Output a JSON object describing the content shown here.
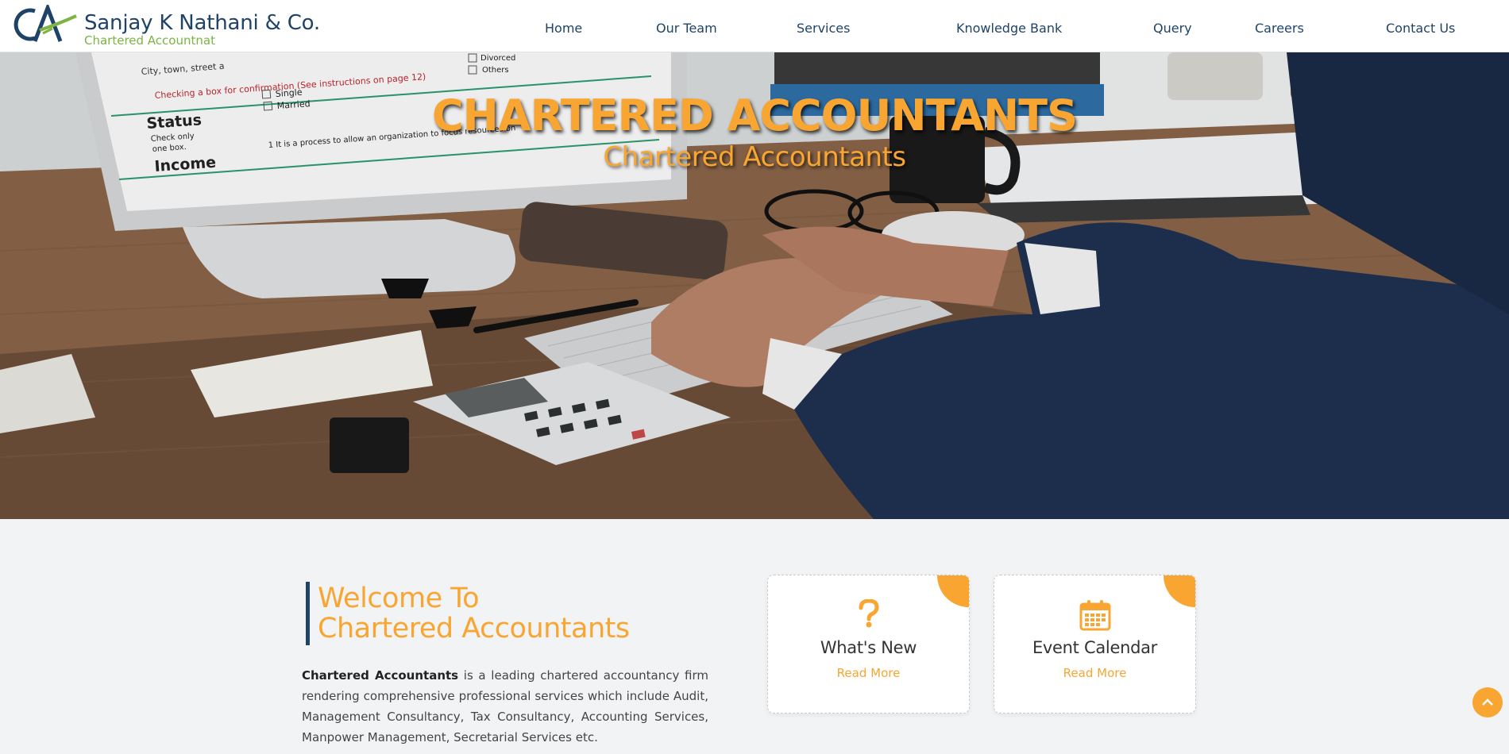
{
  "header": {
    "brand_name": "Sanjay K Nathani & Co.",
    "brand_subtitle": "Chartered Accountnat",
    "logo_text": "CA",
    "nav": [
      "Home",
      "Our Team",
      "Services",
      "Knowledge Bank",
      "Query",
      "Careers",
      "Contact Us"
    ]
  },
  "hero": {
    "title": "CHARTERED ACCOUNTANTS",
    "subtitle": "Chartered Accountants",
    "form_lines": [
      "City, town, street a",
      "Checking a box for confirmation (See instructions on page 12)",
      "Status",
      "Check only",
      "one box.",
      "Single",
      "Married",
      "Divorced",
      "Others",
      "Income",
      "1  It is a process to allow an organization to focus resources on"
    ]
  },
  "welcome": {
    "title_line1": "Welcome To",
    "title_line2": "Chartered Accountants",
    "text_bold": "Chartered Accountants",
    "text_rest": " is a leading chartered accountancy firm rendering comprehensive professional services which include Audit, Management Consultancy, Tax Consultancy, Accounting Services, Manpower Management, Secretarial Services etc."
  },
  "cards": [
    {
      "icon": "question-icon",
      "title": "What's New",
      "link": "Read More"
    },
    {
      "icon": "calendar-icon",
      "title": "Event Calendar",
      "link": "Read More"
    }
  ],
  "colors": {
    "accent": "#f8a532",
    "brand": "#1f4368",
    "green": "#7cb342"
  }
}
